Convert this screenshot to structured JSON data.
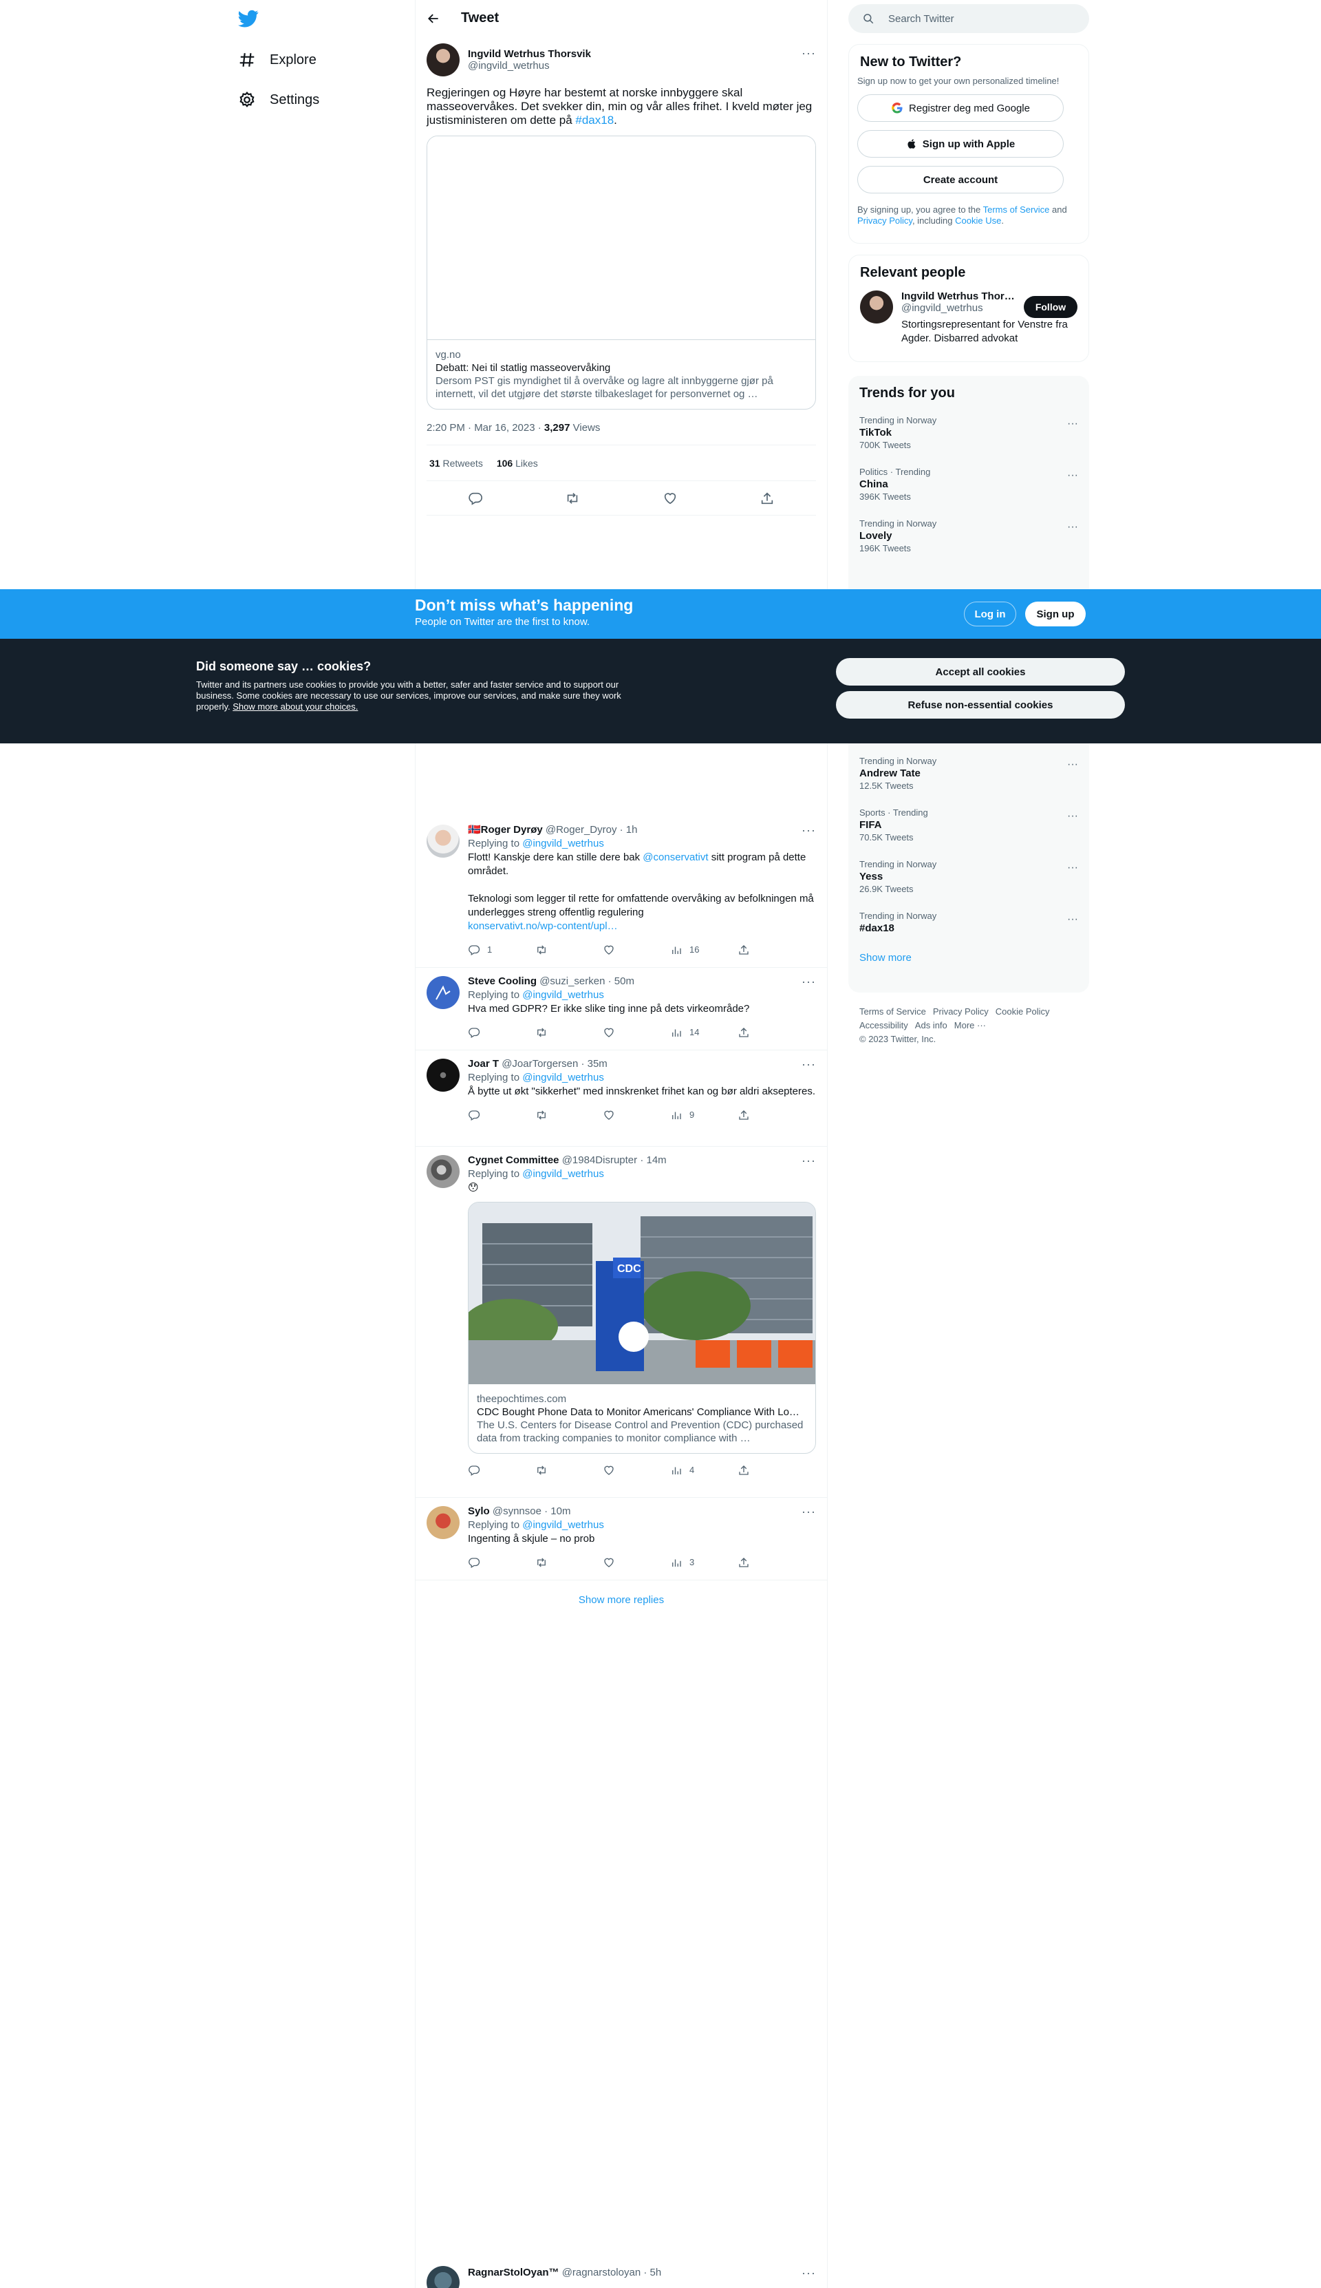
{
  "nav": {
    "explore": "Explore",
    "settings": "Settings"
  },
  "header": {
    "title": "Tweet"
  },
  "tweet": {
    "name": "Ingvild Wetrhus Thorsvik",
    "handle": "@ingvild_wetrhus",
    "text": "Regjeringen og Høyre har bestemt at norske innbyggere skal masseovervåkes. Det svekker din, min og vår alles frihet. I kveld møter jeg justisministeren om dette på ",
    "hashtag": "#dax18",
    "text_end": ".",
    "card": {
      "domain": "vg.no",
      "title": "Debatt: Nei til statlig masseovervåking",
      "description": "Dersom PST gis myndighet til å overvåke og lagre alt innbyggerne gjør på internett, vil det utgjøre det største tilbakeslaget for personvernet og …"
    },
    "time": "2:20 PM · Mar 16, 2023 · ",
    "views_count": "3,297",
    "views_label": " Views",
    "retweets_count": "31",
    "retweets_label": " Retweets",
    "likes_count": "106",
    "likes_label": " Likes"
  },
  "replies": [
    {
      "name": "🇳🇴Roger Dyrøy",
      "handle": "@Roger_Dyroy",
      "time": " · 1h",
      "replying": "Replying to ",
      "replying_to": "@ingvild_wetrhus",
      "text1": "Flott! Kanskje dere kan stille dere bak ",
      "mention": "@conservativt",
      "text2": " sitt program på dette området.",
      "text3": "Teknologi som legger til rette for omfattende overvåking av befolkningen må underlegges streng offentlig regulering",
      "link": "konservativt.no/wp-content/upl…",
      "reply_count": "1",
      "views": "16"
    },
    {
      "name": "Steve Cooling",
      "handle": "@suzi_serken",
      "time": " · 50m",
      "replying": "Replying to ",
      "replying_to": "@ingvild_wetrhus",
      "text": "Hva med GDPR?  Er ikke slike ting inne på dets virkeområde?",
      "views": "14"
    },
    {
      "name": "Joar T",
      "handle": "@JoarTorgersen",
      "time": " · 35m",
      "replying": "Replying to ",
      "replying_to": "@ingvild_wetrhus",
      "text": "Å bytte ut økt \"sikkerhet\" med innskrenket frihet kan og bør aldri aksepteres.",
      "views": "9"
    },
    {
      "name": "Cygnet Committee",
      "handle": "@1984Disrupter",
      "time": " · 14m",
      "replying": "Replying to ",
      "replying_to": "@ingvild_wetrhus",
      "text": "😯",
      "card": {
        "domain": "theepochtimes.com",
        "title": "CDC Bought Phone Data to Monitor Americans' Compliance With Lo…",
        "description": "The U.S. Centers for Disease Control and Prevention (CDC) purchased data from tracking companies to monitor compliance with …",
        "sign_text": "CDC"
      },
      "views": "4"
    },
    {
      "name": "Sylo",
      "handle": "@synnsoe",
      "time": " · 10m",
      "replying": "Replying to ",
      "replying_to": "@ingvild_wetrhus",
      "text": "Ingenting å skjule – no prob",
      "views": "3"
    },
    {
      "name": "RagnarStolOyan™",
      "handle": "@ragnarstoloyan",
      "time": " · 5h"
    }
  ],
  "show_more_replies": "Show more replies",
  "search": {
    "placeholder": "Search Twitter"
  },
  "new_to_twitter": {
    "title": "New to Twitter?",
    "subtitle": "Sign up now to get your own personalized timeline!",
    "google": "Registrer deg med Google",
    "apple": "Sign up with Apple",
    "create": "Create account",
    "terms_1": "By signing up, you agree to the ",
    "terms_link": "Terms of Service",
    "terms_2": " and ",
    "privacy_link": "Privacy Policy",
    "terms_3": ", including ",
    "cookie_link": "Cookie Use",
    "terms_4": "."
  },
  "relevant": {
    "title": "Relevant people",
    "name": "Ingvild Wetrhus Thor…",
    "handle": "@ingvild_wetrhus",
    "follow": "Follow",
    "bio": "Stortingsrepresentant for Venstre fra Agder. Disbarred advokat"
  },
  "trends": {
    "title": "Trends for you",
    "items_top": [
      {
        "category": "Trending in Norway",
        "name": "TikTok",
        "count": "700K Tweets"
      },
      {
        "category": "Politics · Trending",
        "name": "China",
        "count": "396K Tweets"
      },
      {
        "category": "Trending in Norway",
        "name": "Lovely",
        "count": "196K Tweets"
      }
    ],
    "items_bottom": [
      {
        "category": "Trending in Norway",
        "name": "Andrew Tate",
        "count": "12.5K Tweets"
      },
      {
        "category": "Sports · Trending",
        "name": "FIFA",
        "count": "70.5K Tweets"
      },
      {
        "category": "Trending in Norway",
        "name": "Yess",
        "count": "26.9K Tweets"
      },
      {
        "category": "Trending in Norway",
        "name": "#dax18",
        "count": ""
      }
    ],
    "show_more": "Show more"
  },
  "footer": {
    "terms": "Terms of Service",
    "privacy": "Privacy Policy",
    "cookie": "Cookie Policy",
    "accessibility": "Accessibility",
    "ads": "Ads info",
    "more": "More ···",
    "copyright": "© 2023 Twitter, Inc."
  },
  "bottom_bar": {
    "title": "Don’t miss what’s happening",
    "subtitle": "People on Twitter are the first to know.",
    "login": "Log in",
    "signup": "Sign up"
  },
  "cookie_banner": {
    "title": "Did someone say … cookies?",
    "body": "Twitter and its partners use cookies to provide you with a better, safer and faster service and to support our business. Some cookies are necessary to use our services, improve our services, and make sure they work properly. ",
    "link": "Show more about your choices.",
    "accept": "Accept all cookies",
    "refuse": "Refuse non-essential cookies"
  },
  "colors": {
    "accent": "#1d9bf0",
    "banner": "#15202b",
    "text": "#0f1419",
    "muted": "#536471"
  }
}
